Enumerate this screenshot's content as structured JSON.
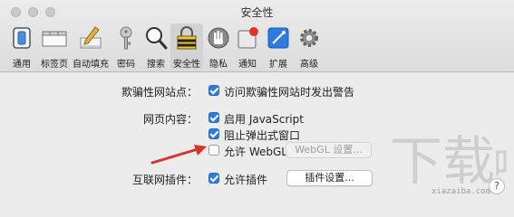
{
  "window": {
    "title": "安全性"
  },
  "toolbar": {
    "items": [
      {
        "label": "通用",
        "icon": "general-switch-icon"
      },
      {
        "label": "标签页",
        "icon": "tabs-icon"
      },
      {
        "label": "自动填充",
        "icon": "autofill-pencil-icon"
      },
      {
        "label": "密码",
        "icon": "key-icon"
      },
      {
        "label": "搜索",
        "icon": "search-magnifier-icon"
      },
      {
        "label": "安全性",
        "icon": "security-lock-icon",
        "selected": true
      },
      {
        "label": "隐私",
        "icon": "privacy-hand-icon"
      },
      {
        "label": "通知",
        "icon": "notification-badge-icon"
      },
      {
        "label": "扩展",
        "icon": "extensions-puzzle-icon"
      },
      {
        "label": "高级",
        "icon": "advanced-gear-icon"
      }
    ]
  },
  "fraud": {
    "label": "欺骗性网站点：",
    "option": "访问欺骗性网站时发出警告",
    "checked": true
  },
  "web_content": {
    "label": "网页内容：",
    "javascript": "启用 JavaScript",
    "javascript_checked": true,
    "popups": "阻止弹出式窗口",
    "popups_checked": true,
    "webgl": "允许 WebGL",
    "webgl_checked": false,
    "webgl_button": "WebGL 设置..."
  },
  "plugins": {
    "label": "互联网插件：",
    "option": "允许插件",
    "checked": true,
    "button": "插件设置..."
  },
  "help": {
    "label": "?"
  },
  "colors": {
    "accent": "#2f7de1",
    "arrow": "#d8322a"
  },
  "watermark": {
    "text": "xiazaiba.com"
  }
}
